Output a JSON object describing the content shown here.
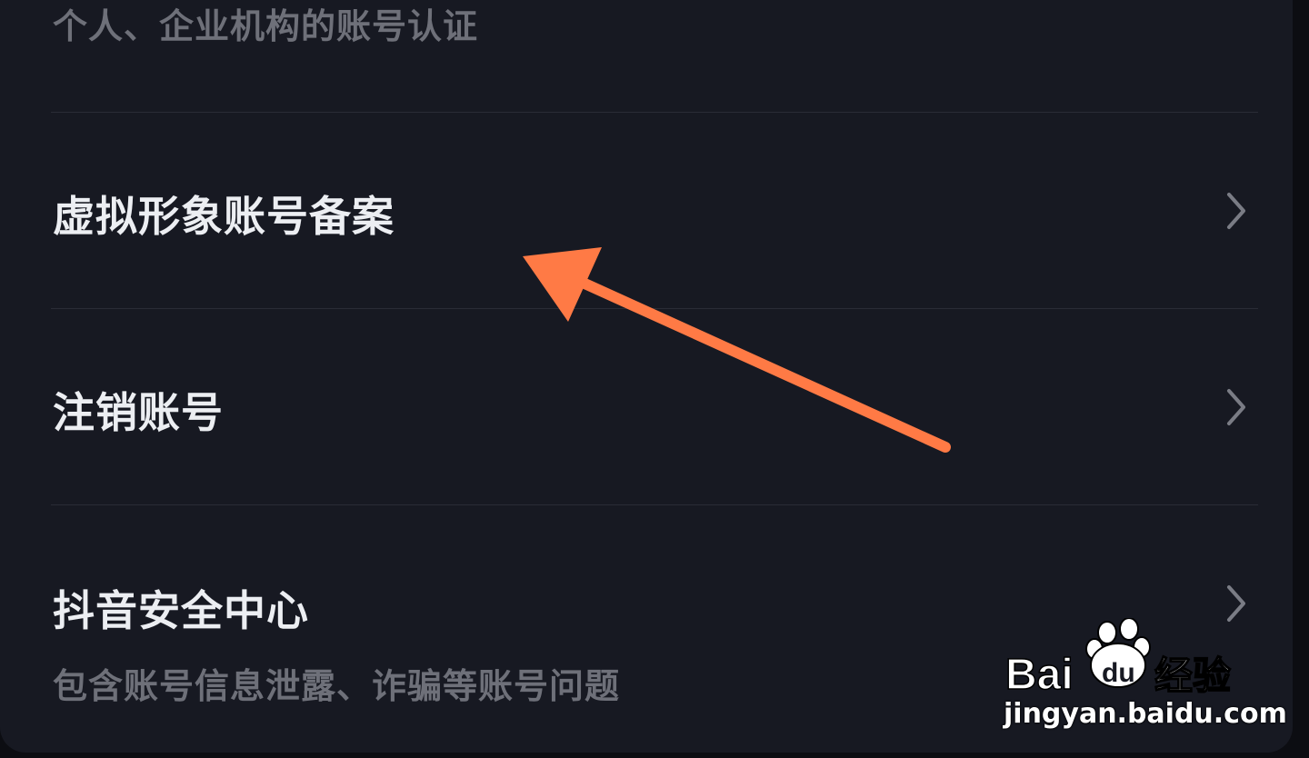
{
  "menu": {
    "items": [
      {
        "subtitle": "个人、企业机构的账号认证"
      },
      {
        "title": "虚拟形象账号备案"
      },
      {
        "title": "注销账号"
      },
      {
        "title": "抖音安全中心",
        "subtitle": "包含账号信息泄露、诈骗等账号问题"
      }
    ]
  },
  "annotation": {
    "arrow_color": "#ff7a45"
  },
  "watermark": {
    "brand": "Baidu经验",
    "url": "jingyan.baidu.com"
  },
  "colors": {
    "background": "#171922",
    "title": "#eceef2",
    "subtitle": "#6e7079",
    "divider": "#2a2c36",
    "chevron": "#7a7c85"
  }
}
